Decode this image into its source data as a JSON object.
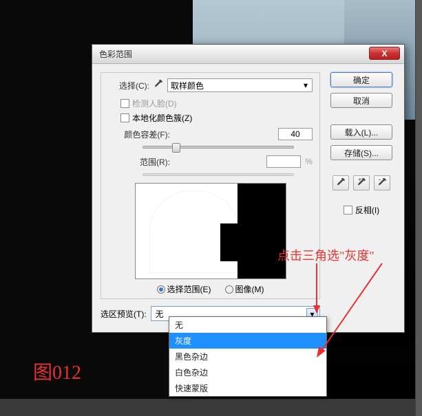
{
  "figure_label": "图012",
  "dialog": {
    "title": "色彩范围",
    "select_label": "选择(C):",
    "select_value": "取样颜色",
    "detect_faces": "检测人脸(D)",
    "localized": "本地化颜色簇(Z)",
    "fuzziness_label": "颜色容差(F):",
    "fuzziness_value": "40",
    "range_label": "范围(R):",
    "range_unit": "%",
    "radio_selection": "选择范围(E)",
    "radio_image": "图像(M)",
    "preview_label": "选区预览(T):",
    "preview_value": "无"
  },
  "buttons": {
    "ok": "确定",
    "cancel": "取消",
    "load": "载入(L)...",
    "save": "存储(S)...",
    "invert": "反相(I)"
  },
  "dropdown": {
    "items": [
      "无",
      "灰度",
      "黑色杂边",
      "白色杂边",
      "快速蒙版"
    ],
    "selected_index": 1
  },
  "annotation": {
    "text": "点击三角选\"灰度\""
  },
  "icons": {
    "close": "X",
    "arrow_down": "▼",
    "arrow_down_small": "▾"
  }
}
